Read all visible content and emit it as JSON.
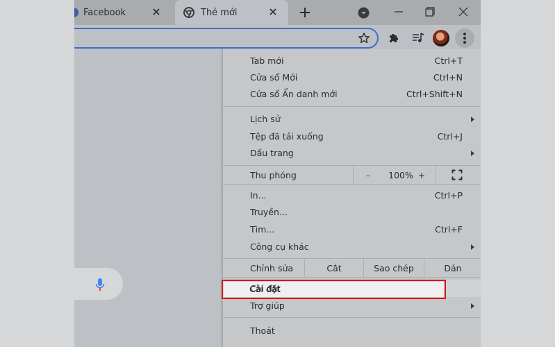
{
  "tabs": [
    {
      "title": "Facebook"
    },
    {
      "title": "Thẻ mới"
    }
  ],
  "menu": {
    "new_tab": {
      "label": "Tab mới",
      "shortcut": "Ctrl+T"
    },
    "new_window": {
      "label": "Cửa sổ Mới",
      "shortcut": "Ctrl+N"
    },
    "incognito": {
      "label": "Cửa sổ Ẩn danh mới",
      "shortcut": "Ctrl+Shift+N"
    },
    "history": {
      "label": "Lịch sử"
    },
    "downloads": {
      "label": "Tệp đã tải xuống",
      "shortcut": "Ctrl+J"
    },
    "bookmarks": {
      "label": "Dấu trang"
    },
    "zoom": {
      "label": "Thu phóng",
      "minus": "–",
      "value": "100%",
      "plus": "+"
    },
    "print": {
      "label": "In...",
      "shortcut": "Ctrl+P"
    },
    "cast": {
      "label": "Truyền..."
    },
    "find": {
      "label": "Tìm...",
      "shortcut": "Ctrl+F"
    },
    "more_tools": {
      "label": "Công cụ khác"
    },
    "edit": {
      "label": "Chỉnh sửa",
      "cut": "Cắt",
      "copy": "Sao chép",
      "paste": "Dán"
    },
    "settings": {
      "label": "Cài đặt"
    },
    "help": {
      "label": "Trợ giúp"
    },
    "exit": {
      "label": "Thoát"
    }
  },
  "colors": {
    "highlight_border": "#d5161d",
    "omnibox_focus": "#3b6fcb",
    "mic_blue": "#4285f4",
    "mic_red": "#ea4335"
  },
  "icons": [
    "chrome-icon",
    "close-icon",
    "plus-icon",
    "tab-search-icon",
    "minimize-icon",
    "maximize-icon",
    "star-icon",
    "puzzle-icon",
    "media-icon",
    "kebab-icon",
    "mic-icon",
    "fullscreen-icon",
    "chevron-right-icon"
  ]
}
